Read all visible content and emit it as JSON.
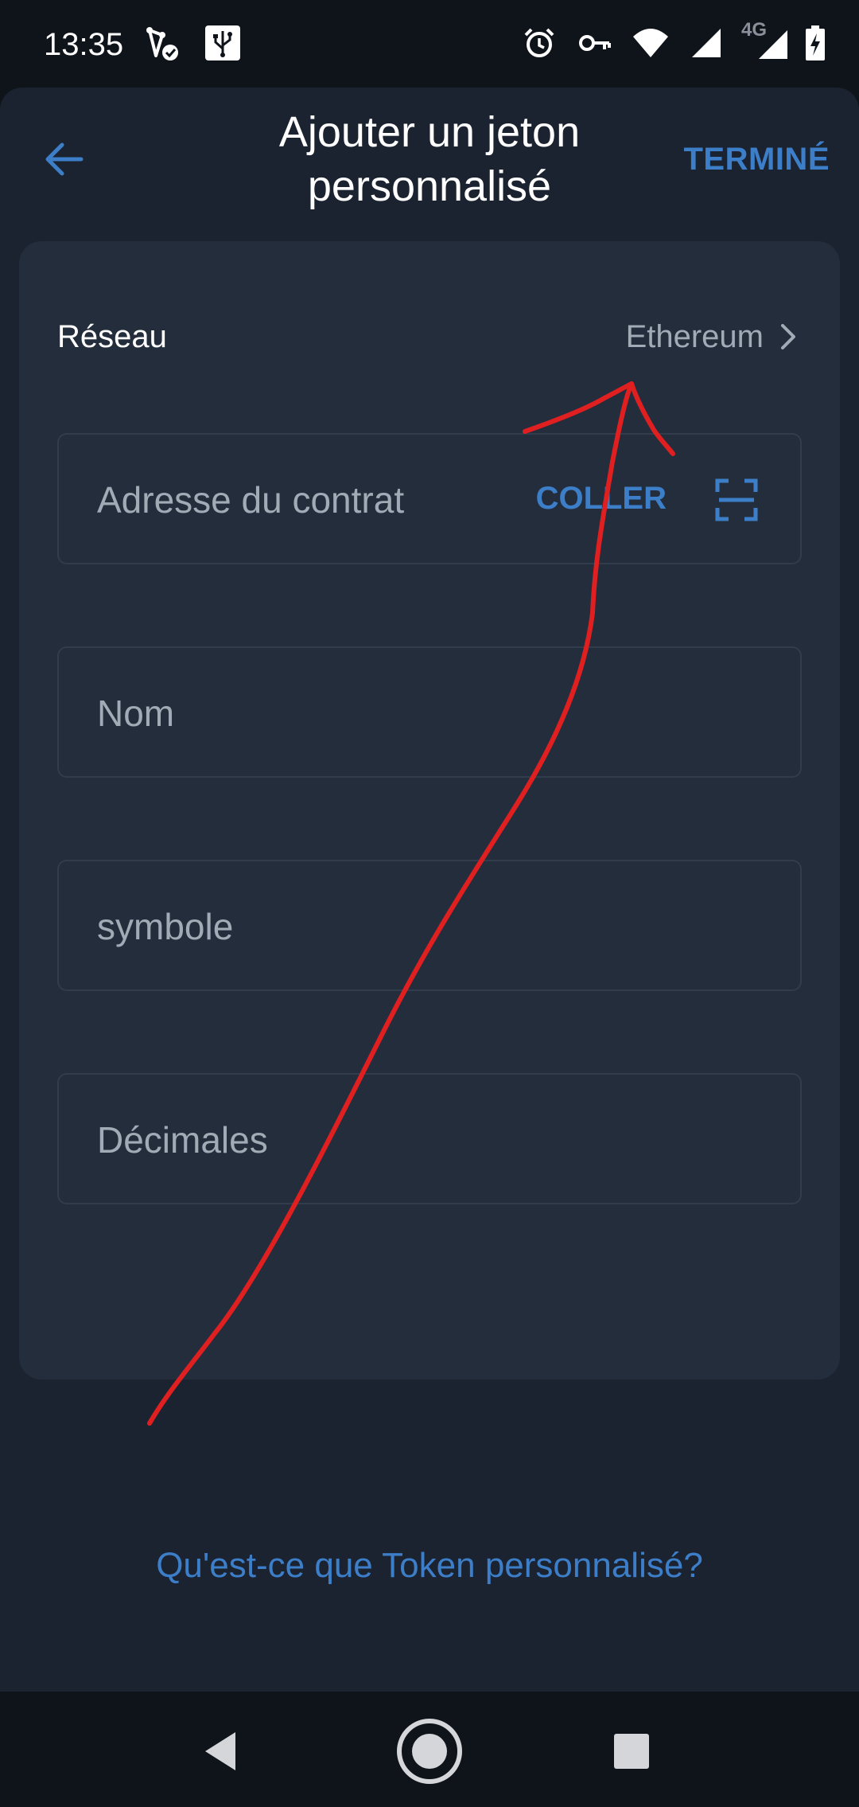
{
  "status_bar": {
    "time": "13:35",
    "network_type": "4G",
    "icons_left": [
      "sync-check-icon",
      "usb-icon"
    ],
    "icons_right": [
      "alarm-icon",
      "vpn-key-icon",
      "wifi-icon",
      "signal-icon",
      "signal-4g-icon",
      "battery-charging-icon"
    ]
  },
  "header": {
    "title": "Ajouter un jeton personnalisé",
    "done_label": "TERMINÉ",
    "back_icon": "arrow-left-icon"
  },
  "network": {
    "label": "Réseau",
    "value": "Ethereum",
    "chevron_icon": "chevron-right-icon"
  },
  "fields": {
    "contract_address": {
      "placeholder": "Adresse du contrat",
      "value": "",
      "paste_label": "COLLER",
      "scan_icon": "qr-scan-icon"
    },
    "name": {
      "placeholder": "Nom",
      "value": ""
    },
    "symbol": {
      "placeholder": "symbole",
      "value": ""
    },
    "decimals": {
      "placeholder": "Décimales",
      "value": ""
    }
  },
  "help_link": "Qu'est-ce que Token personnalisé?",
  "colors": {
    "background": "#0f131a",
    "sheet": "#1b2230",
    "card": "#232d3c",
    "accent": "#3d7ec9",
    "text": "#ffffff",
    "muted_text": "#a2aab6",
    "annotation": "#e02020"
  },
  "nav_bar": {
    "icons": [
      "back-triangle-icon",
      "home-circle-icon",
      "recents-square-icon"
    ]
  }
}
